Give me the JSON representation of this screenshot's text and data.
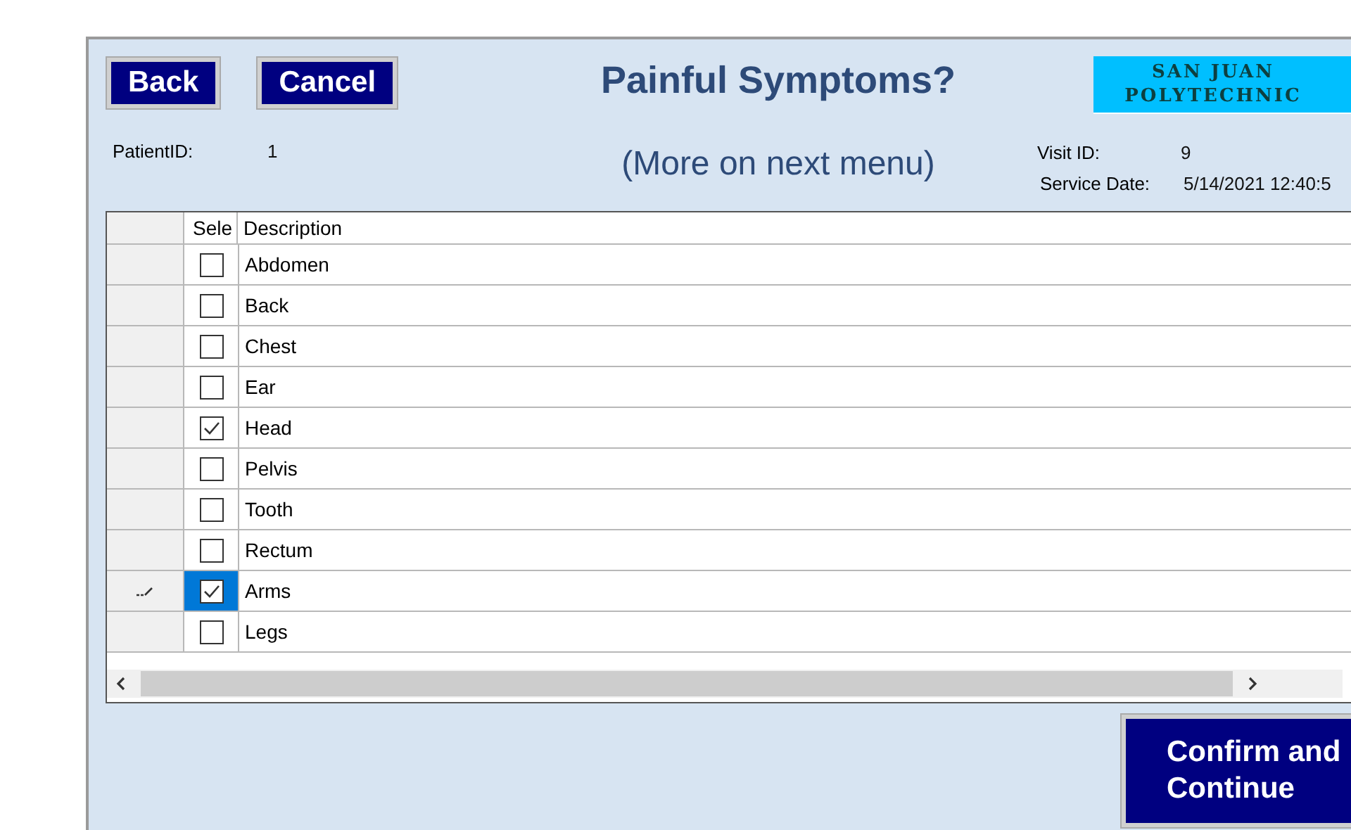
{
  "buttons": {
    "back": "Back",
    "cancel": "Cancel",
    "confirm": "Confirm and Continue"
  },
  "title": "Painful Symptoms?",
  "subtitle": "(More on next menu)",
  "logo": [
    "SAN JUAN",
    "POLYTECHNIC"
  ],
  "patient": {
    "label": "PatientID:",
    "value": "1"
  },
  "visit": [
    {
      "label": "Visit ID:",
      "value": "9"
    },
    {
      "label": "Service Date:",
      "value": "5/14/2021 12:40:5"
    }
  ],
  "table": {
    "columns": [
      "Sele",
      "Description"
    ],
    "rows": [
      {
        "description": "Abdomen",
        "checked": false,
        "selected": false
      },
      {
        "description": "Back",
        "checked": false,
        "selected": false
      },
      {
        "description": "Chest",
        "checked": false,
        "selected": false
      },
      {
        "description": "Ear",
        "checked": false,
        "selected": false
      },
      {
        "description": "Head",
        "checked": true,
        "selected": false
      },
      {
        "description": "Pelvis",
        "checked": false,
        "selected": false
      },
      {
        "description": "Tooth",
        "checked": false,
        "selected": false
      },
      {
        "description": "Rectum",
        "checked": false,
        "selected": false
      },
      {
        "description": "Arms",
        "checked": true,
        "selected": true
      },
      {
        "description": "Legs",
        "checked": false,
        "selected": false
      }
    ]
  }
}
